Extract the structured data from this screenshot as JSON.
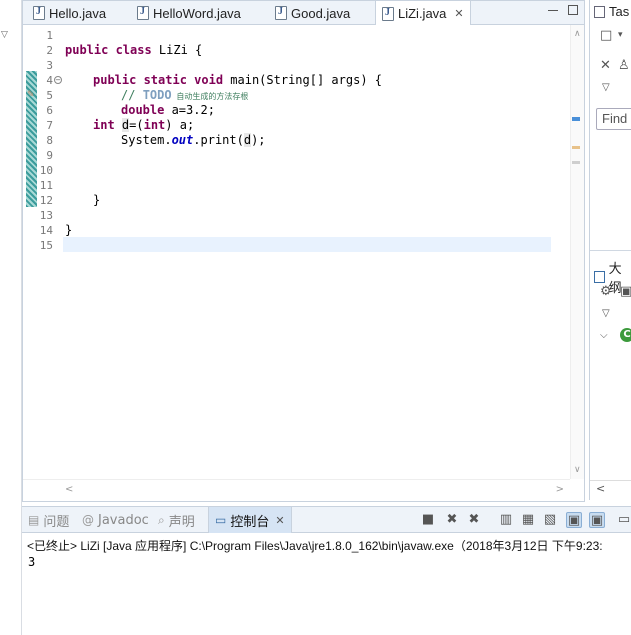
{
  "editor": {
    "tabs": [
      {
        "label": "Hello.java",
        "active": false
      },
      {
        "label": "HelloWord.java",
        "active": false
      },
      {
        "label": "Good.java",
        "active": false
      },
      {
        "label": "LiZi.java",
        "active": true
      }
    ],
    "close_glyph": "✕",
    "line_numbers": [
      "1",
      "2",
      "3",
      "4",
      "5",
      "6",
      "7",
      "8",
      "9",
      "10",
      "11",
      "12",
      "13",
      "14",
      "15"
    ],
    "code": {
      "l2_kw": "public class",
      "l2_rest": " LiZi {",
      "l4_kw": "public static void",
      "l4_rest": " main(String[] args) {",
      "l5_comment": "// ",
      "l5_todo": "TODO",
      "l5_cn": " 自动生成的方法存根",
      "l6_kw": "double",
      "l6_rest": " a=3.2;",
      "l7_kw": "int",
      "l7_var": "d",
      "l7_mid": "=(",
      "l7_kw2": "int",
      "l7_rest": ") a;",
      "l8_pre": "System.",
      "l8_field": "out",
      "l8_mid": ".print(",
      "l8_var": "d",
      "l8_end": ");",
      "l12": "}",
      "l14": "}"
    }
  },
  "right_panel": {
    "task_tab": "Tas",
    "find_placeholder": "Find",
    "outline_tab": "大纲",
    "class_badge": "C"
  },
  "console": {
    "tabs": [
      {
        "label": "问题",
        "icon": "problems-icon"
      },
      {
        "label": "Javadoc",
        "icon": "at-icon"
      },
      {
        "label": "声明",
        "icon": "declaration-icon"
      },
      {
        "label": "控制台",
        "icon": "console-icon",
        "active": true
      }
    ],
    "status": "<已终止> LiZi [Java 应用程序] C:\\Program Files\\Java\\jre1.8.0_162\\bin\\javaw.exe（2018年3月12日 下午9:23:",
    "output": "3"
  }
}
